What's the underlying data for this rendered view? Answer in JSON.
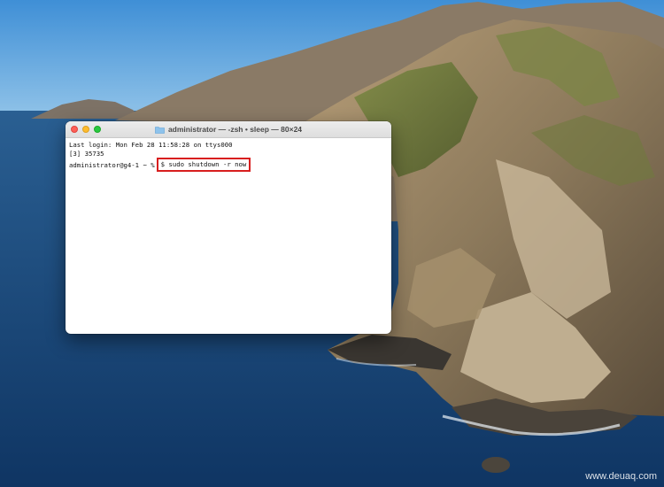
{
  "terminal": {
    "title": "administrator — -zsh • sleep — 80×24",
    "lines": [
      "Last login: Mon Feb 28 11:58:28 on ttys000",
      "[3] 35735"
    ],
    "prompt": "administrator@g4-1 ~ %",
    "command": "$ sudo shutdown -r now"
  },
  "icons": {
    "close": "close-icon",
    "minimize": "minimize-icon",
    "maximize": "maximize-icon",
    "folder": "folder-icon"
  },
  "colors": {
    "highlight_box": "#d81e1e",
    "close": "#fe5f57",
    "minimize": "#febc2e",
    "maximize": "#28c840"
  },
  "watermark": "www.deuaq.com"
}
